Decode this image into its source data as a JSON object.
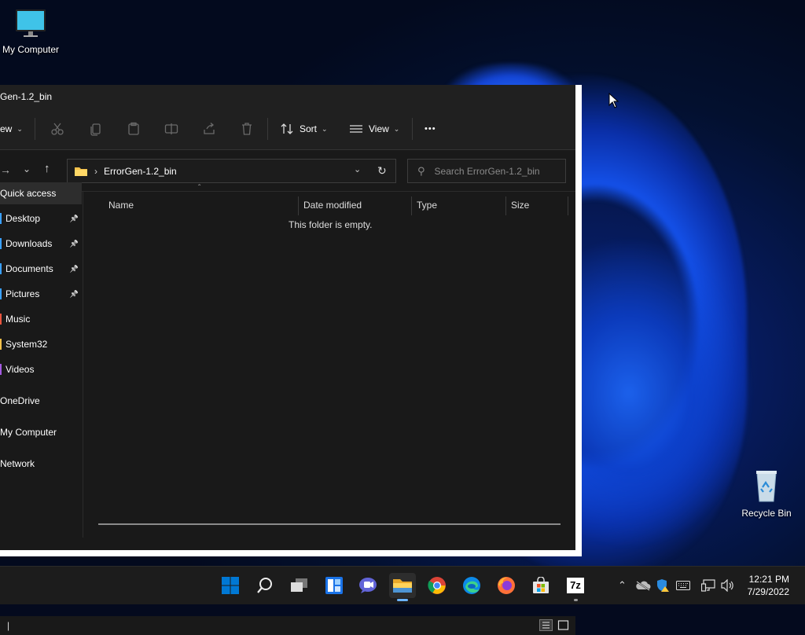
{
  "desktop": {
    "icons": [
      {
        "label": "My Computer"
      },
      {
        "label": "Recycle Bin"
      }
    ]
  },
  "window": {
    "title": "Gen-1.2_bin",
    "toolbar": {
      "new_label": "ew",
      "sort_label": "Sort",
      "view_label": "View",
      "more_label": "•••"
    },
    "address": {
      "path": "ErrorGen-1.2_bin",
      "search_placeholder": "Search ErrorGen-1.2_bin"
    },
    "nav": {
      "items": [
        {
          "label": "Quick access",
          "pinned": false
        },
        {
          "label": "Desktop",
          "pinned": true
        },
        {
          "label": "Downloads",
          "pinned": true
        },
        {
          "label": "Documents",
          "pinned": true
        },
        {
          "label": "Pictures",
          "pinned": true
        },
        {
          "label": "Music",
          "pinned": false
        },
        {
          "label": "System32",
          "pinned": false
        },
        {
          "label": "Videos",
          "pinned": false
        },
        {
          "label": "OneDrive",
          "pinned": false
        },
        {
          "label": "My Computer",
          "pinned": false
        },
        {
          "label": "Network",
          "pinned": false
        }
      ]
    },
    "columns": {
      "name": "Name",
      "date": "Date modified",
      "type": "Type",
      "size": "Size"
    },
    "empty_message": "This folder is empty.",
    "status_text": "|"
  },
  "taskbar": {
    "clock_time": "12:21 PM",
    "clock_date": "7/29/2022",
    "sevenzip_label": "7z",
    "colors": {
      "accent": "#0078d4",
      "folder": "#f3c14b"
    }
  }
}
